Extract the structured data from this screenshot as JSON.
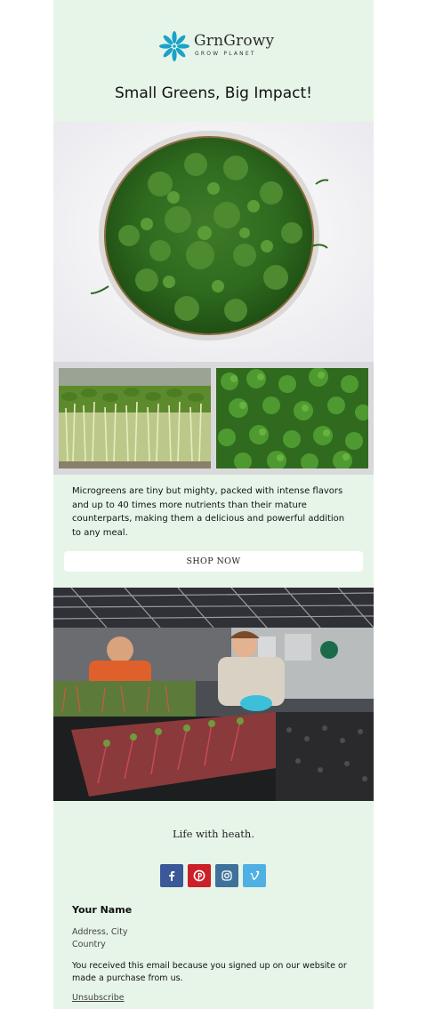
{
  "header": {
    "brand_name": "GrnGrowy",
    "tagline": "GROW PLANET",
    "logo_icon": "flower-icon",
    "headline": "Small Greens, Big Impact!"
  },
  "images": {
    "hero": "microgreens-bowl-top-view",
    "left": "pea-shoots-side-view",
    "right": "microgreen-leaves-closeup",
    "photo": "two-people-tending-microgreen-trays"
  },
  "content": {
    "description": "Microgreens are tiny but mighty, packed with intense flavors and up to 40 times more nutrients than their mature counterparts, making them a delicious and powerful addition to any meal.",
    "cta_label": "SHOP NOW"
  },
  "footer": {
    "slogan": "Life with heath.",
    "social": [
      {
        "icon": "facebook-icon"
      },
      {
        "icon": "pinterest-icon"
      },
      {
        "icon": "instagram-icon"
      },
      {
        "icon": "vimeo-icon"
      }
    ],
    "name": "Your Name",
    "address_line1": "Address, City",
    "address_line2": "Country",
    "notice": "You received this email because you signed up on our website or made a purchase from us.",
    "unsubscribe": "Unsubscribe"
  },
  "colors": {
    "background": "#e7f5e8",
    "logo_accent": "#1aa3c9",
    "facebook": "#3b5998",
    "pinterest": "#cb2027",
    "instagram": "#3f729b",
    "vimeo": "#4fb0e3"
  }
}
